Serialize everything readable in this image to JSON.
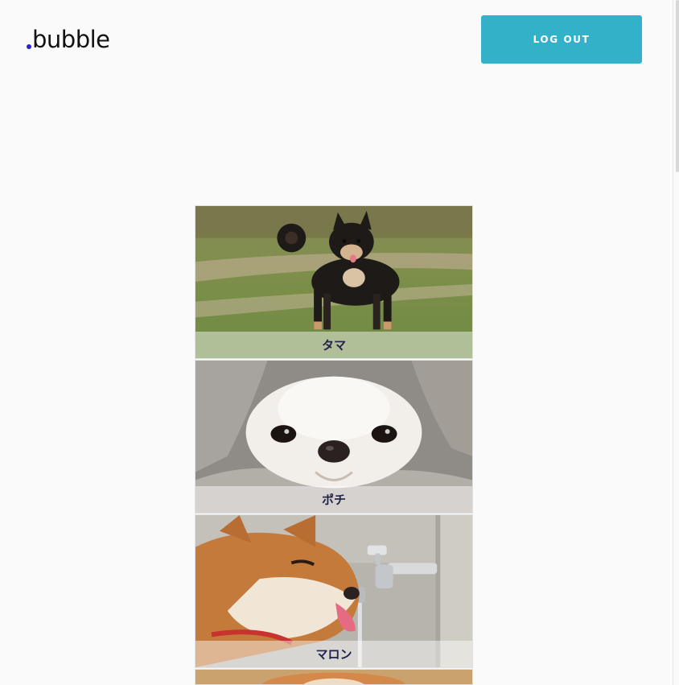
{
  "header": {
    "logo_text": "bubble",
    "logout_label": "LOG OUT"
  },
  "pets": [
    {
      "name": "タマ",
      "photo": "black-shiba-on-path-photo"
    },
    {
      "name": "ポチ",
      "photo": "white-chihuahua-in-blanket-photo"
    },
    {
      "name": "マロン",
      "photo": "shiba-drinking-from-faucet-photo"
    }
  ],
  "colors": {
    "accent": "#33b1c9",
    "logo_dot": "#2a22d6",
    "caption_text": "#23234a",
    "background": "#fafafa"
  }
}
